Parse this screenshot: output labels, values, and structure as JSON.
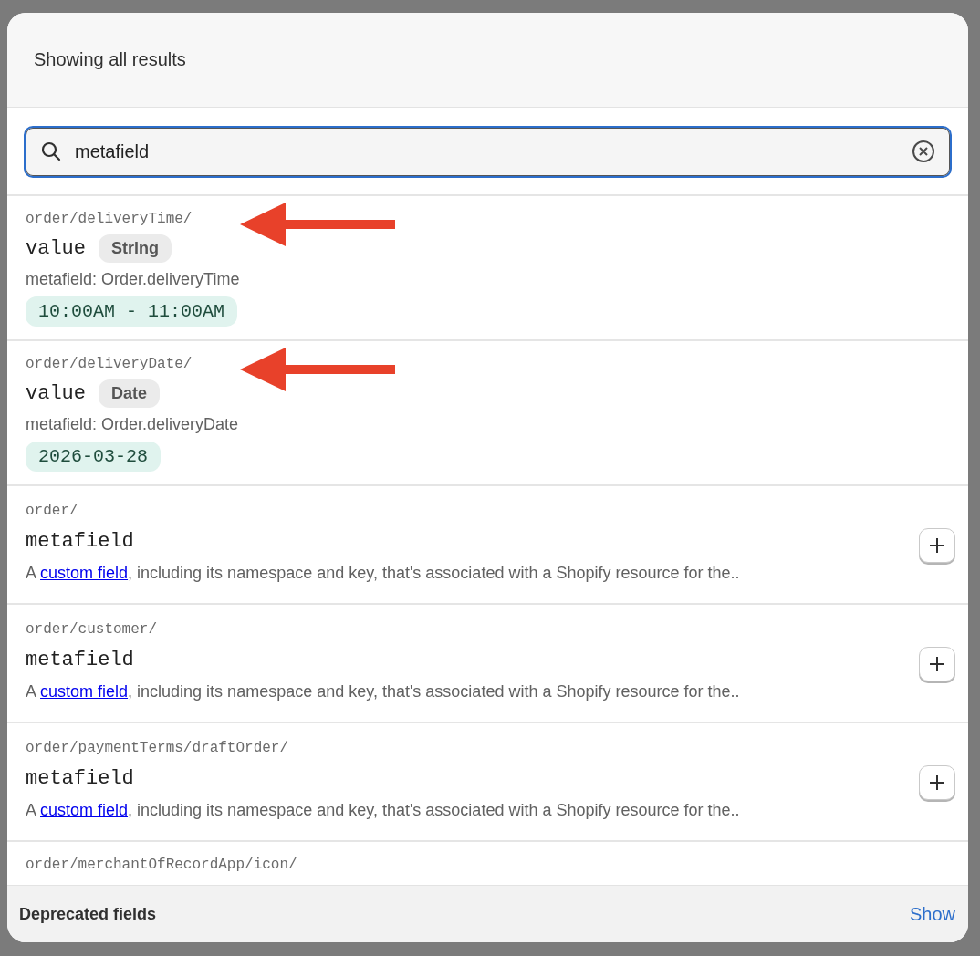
{
  "header": {
    "title": "Showing all results"
  },
  "search": {
    "value": "metafield"
  },
  "results": [
    {
      "kind": "value",
      "path": "order/deliveryTime/",
      "highlighted": true,
      "name": "value",
      "type": "String",
      "source": "metafield: Order.deliveryTime",
      "sample": "10:00AM - 11:00AM"
    },
    {
      "kind": "value",
      "path": "order/deliveryDate/",
      "highlighted": true,
      "name": "value",
      "type": "Date",
      "source": "metafield: Order.deliveryDate",
      "sample": "2026-03-28"
    },
    {
      "kind": "field",
      "path": "order/",
      "highlighted": false,
      "name": "metafield",
      "description_before": "A ",
      "link": "custom field",
      "description_after": ", including its namespace and key, that's associated with a Shopify resource for the.."
    },
    {
      "kind": "field",
      "path": "order/customer/",
      "highlighted": false,
      "name": "metafield",
      "description_before": "A ",
      "link": "custom field",
      "description_after": ", including its namespace and key, that's associated with a Shopify resource for the.."
    },
    {
      "kind": "field",
      "path": "order/paymentTerms/draftOrder/",
      "highlighted": false,
      "name": "metafield",
      "description_before": "A ",
      "link": "custom field",
      "description_after": ", including its namespace and key, that's associated with a Shopify resource for the.."
    },
    {
      "kind": "partial",
      "path": "order/merchantOfRecordApp/icon/"
    }
  ],
  "footer": {
    "label": "Deprecated fields",
    "action": "Show"
  }
}
